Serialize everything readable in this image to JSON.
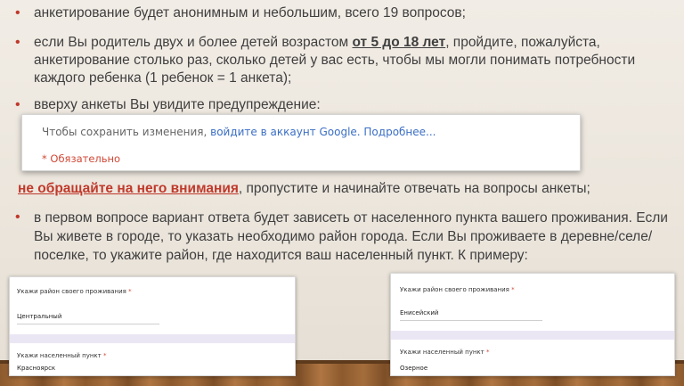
{
  "bullets": [
    {
      "marker": "•",
      "text": "анкетирование будет анонимным и небольшим, всего 19 вопросов;"
    },
    {
      "marker": "•",
      "text_before": "если Вы родитель двух и более детей возрастом ",
      "text_bold": "от 5 до 18 лет",
      "text_after": ", пройдите, пожалуйста, анкетирование столько раз, сколько детей у вас есть, чтобы мы могли понимать потребности каждого ребенка (1 ребенок = 1 анкета);"
    },
    {
      "marker": "•",
      "text": "вверху анкеты Вы увидите предупреждение:"
    }
  ],
  "warning_card": {
    "prefix": "Чтобы сохранить изменения, ",
    "link": "войдите в аккаунт Google. Подробнее...",
    "required": "* Обязательно"
  },
  "instruction": {
    "highlight": "не обращайте на него внимания",
    "rest": ", пропустите и начинайте отвечать на вопросы анкеты;"
  },
  "bullet4": {
    "marker": "•",
    "text": "в первом вопросе вариант ответа будет зависеть от населенного пункта вашего проживания. Если Вы живете в городе, то указать необходимо район города. Если Вы проживаете в деревне/селе/поселке, то укажите район, где находится ваш населенный пункт. К примеру:"
  },
  "form_left": {
    "q1": "Укажи район своего проживания",
    "a1": "Центральный",
    "q2": "Укажи населенный пункт",
    "a2": "Красноярск",
    "req": "*"
  },
  "form_right": {
    "q1": "Укажи район своего проживания",
    "a1": "Енисейский",
    "q2": "Укажи населенный пункт",
    "a2": "Озерное",
    "req": "*"
  }
}
